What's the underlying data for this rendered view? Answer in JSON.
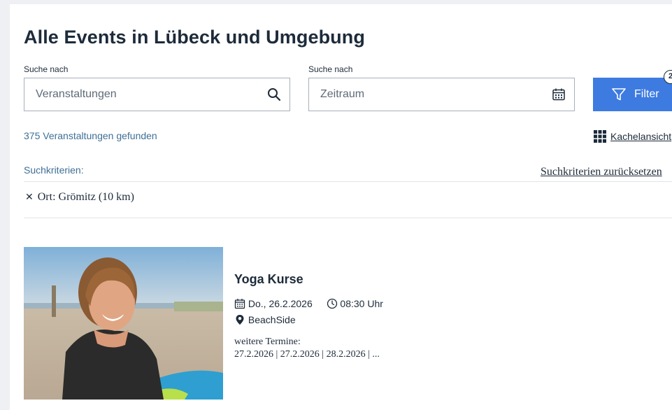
{
  "page": {
    "title": "Alle Events in Lübeck und Umgebung"
  },
  "search": {
    "event_label": "Suche nach",
    "event_placeholder": "Veranstaltungen",
    "date_label": "Suche nach",
    "date_placeholder": "Zeitraum",
    "filter_label": "Filter",
    "filter_badge": "2"
  },
  "results": {
    "count_text": "375 Veranstaltungen gefunden",
    "view_toggle": "Kachelansicht"
  },
  "criteria": {
    "label": "Suchkriterien:",
    "reset": "Suchkriterien zurücksetzen",
    "chips": [
      {
        "label": "Ort: Grömitz (10 km)"
      }
    ]
  },
  "events": [
    {
      "title": "Yoga Kurse",
      "date": "Do., 26.2.2026",
      "time": "08:30 Uhr",
      "location": "BeachSide",
      "more_label": "weitere Termine:",
      "more_dates": "27.2.2026 | 27.2.2026 | 28.2.2026 | ..."
    }
  ],
  "icons": {
    "search": "search-icon",
    "calendar": "calendar-icon",
    "filter": "filter-icon",
    "grid": "grid-icon",
    "clock": "clock-icon",
    "location": "location-pin-icon",
    "close": "close-icon"
  },
  "colors": {
    "primary": "#3d7be0",
    "text": "#1d2b3a",
    "muted": "#3f6f96"
  }
}
